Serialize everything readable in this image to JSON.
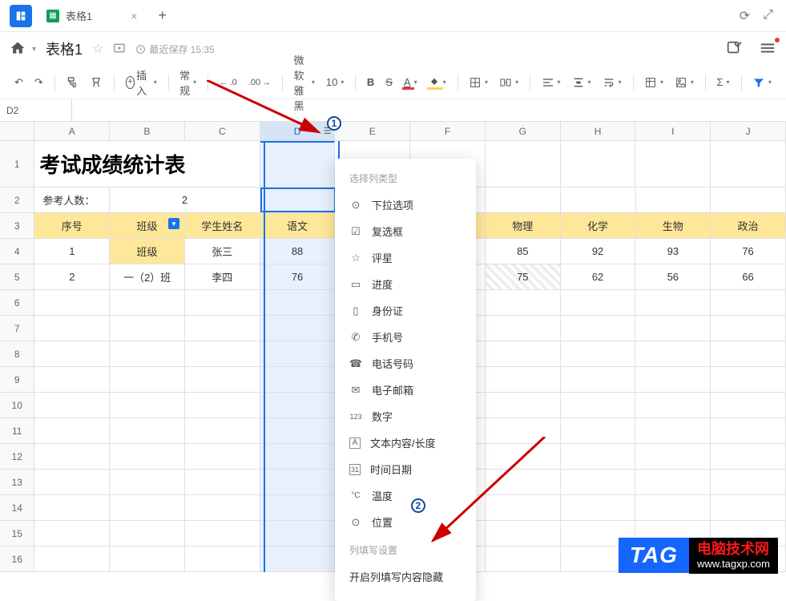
{
  "tab": {
    "title": "表格1"
  },
  "doc": {
    "title": "表格1",
    "save_status": "最近保存 15:35"
  },
  "toolbar": {
    "insert": "插入",
    "format": "常规",
    "decimals_hint": ".0",
    "decimals_hint2": ".00",
    "font": "微软雅黑",
    "font_size": "10"
  },
  "namebox": "D2",
  "columns": [
    "A",
    "B",
    "C",
    "D",
    "E",
    "F",
    "G",
    "H",
    "I",
    "J"
  ],
  "row_numbers": [
    "1",
    "2",
    "3",
    "4",
    "5",
    "6",
    "7",
    "8",
    "9",
    "10",
    "11",
    "12",
    "13",
    "14",
    "15",
    "16"
  ],
  "table": {
    "title": "考试成绩统计表",
    "meta_label": "参考人数：",
    "meta_value": "2",
    "headers": [
      "序号",
      "班级",
      "学生姓名",
      "语文",
      "",
      "",
      "物理",
      "化学",
      "生物",
      "政治"
    ],
    "filter_value": "班级",
    "rows": [
      {
        "idx": "1",
        "class": "班级",
        "name": "张三",
        "chinese": "88",
        "physics": "85",
        "chemistry": "92",
        "biology": "93",
        "politics": "76"
      },
      {
        "idx": "2",
        "class": "一（2）班",
        "name": "李四",
        "chinese": "76",
        "physics": "75",
        "chemistry": "62",
        "biology": "56",
        "politics": "66"
      }
    ]
  },
  "menu": {
    "section1": "选择列类型",
    "items": [
      {
        "icon": "⊙",
        "label": "下拉选项"
      },
      {
        "icon": "☑",
        "label": "复选框"
      },
      {
        "icon": "☆",
        "label": "评星"
      },
      {
        "icon": "▭",
        "label": "进度"
      },
      {
        "icon": "▯",
        "label": "身份证"
      },
      {
        "icon": "✆",
        "label": "手机号"
      },
      {
        "icon": "☎",
        "label": "电话号码"
      },
      {
        "icon": "✉",
        "label": "电子邮箱"
      },
      {
        "icon": "123",
        "label": "数字"
      },
      {
        "icon": "A",
        "label": "文本内容/长度"
      },
      {
        "icon": "31",
        "label": "时间日期"
      },
      {
        "icon": "°C",
        "label": "温度"
      },
      {
        "icon": "⊙",
        "label": "位置"
      }
    ],
    "section2": "列填写设置",
    "action": "开启列填写内容隐藏"
  },
  "badges": {
    "b1": "1",
    "b2": "2"
  },
  "watermark": {
    "tag": "TAG",
    "line1": "电脑技术网",
    "line2": "www.tagxp.com"
  }
}
